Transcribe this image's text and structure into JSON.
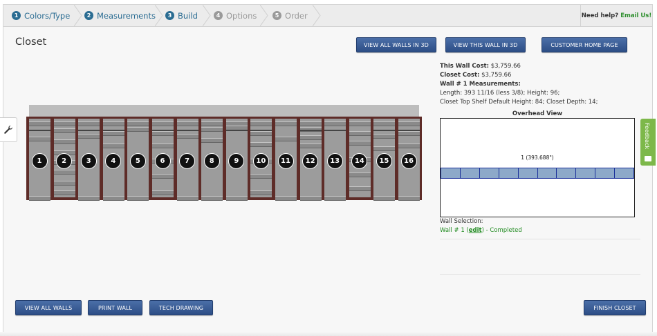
{
  "wizard": {
    "steps": [
      {
        "num": "1",
        "label": "Colors/Type"
      },
      {
        "num": "2",
        "label": "Measurements"
      },
      {
        "num": "3",
        "label": "Build"
      },
      {
        "num": "4",
        "label": "Options"
      },
      {
        "num": "5",
        "label": "Order"
      }
    ],
    "help_label": "Need help?",
    "help_link": "Email Us!"
  },
  "page": {
    "title": "Closet"
  },
  "top_buttons": {
    "view_all_walls_3d": "VIEW ALL WALLS IN 3D",
    "view_this_wall_3d": "VIEW THIS WALL IN 3D",
    "customer_home": "CUSTOMER HOME PAGE"
  },
  "info": {
    "wall_cost_label": "This Wall Cost:",
    "wall_cost_value": "$3,759.66",
    "closet_cost_label": "Closet Cost:",
    "closet_cost_value": "$3,759.66",
    "measurements_heading": "Wall # 1 Measurements:",
    "measurements_line1": "Length: 393 11/16 (less 3/8); Height: 96;",
    "measurements_line2": "Closet Top Shelf Default Height: 84; Closet Depth: 14;"
  },
  "overhead": {
    "title": "Overhead View",
    "wall_label": "1 (393.688\")"
  },
  "wall_selection": {
    "label": "Wall Selection:",
    "prefix": "Wall # 1 (",
    "edit": "edit",
    "suffix": ") - Completed"
  },
  "bays": [
    "1",
    "2",
    "3",
    "4",
    "5",
    "6",
    "7",
    "8",
    "9",
    "10",
    "11",
    "12",
    "13",
    "14",
    "15",
    "16"
  ],
  "bottom_buttons": {
    "view_all_walls": "VIEW ALL WALLS",
    "print_wall": "PRINT WALL",
    "tech_drawing": "TECH DRAWING",
    "finish_closet": "FINISH CLOSET"
  },
  "feedback": {
    "label": "Feedback"
  },
  "colors": {
    "accent": "#2a6c92",
    "button": "#3a5c95",
    "closet_frame": "#5e2c28",
    "success": "#1f8a1f"
  }
}
